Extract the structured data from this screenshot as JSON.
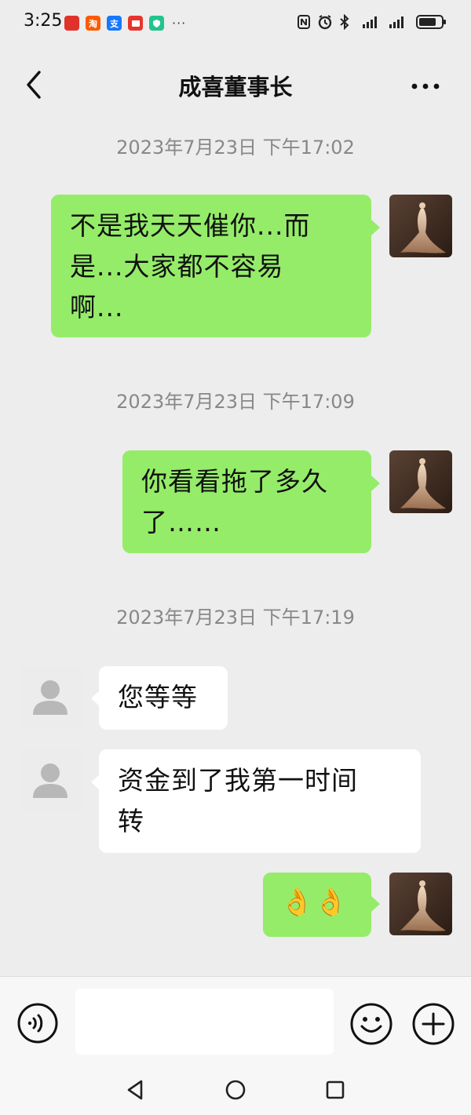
{
  "status_bar": {
    "time": "3:25",
    "app_icons": [
      {
        "name": "huawei-mall-icon",
        "color": "#e0322b",
        "glyph": ""
      },
      {
        "name": "taobao-icon",
        "color": "#ff5a00",
        "glyph": "淘"
      },
      {
        "name": "alipay-icon",
        "color": "#1677ff",
        "glyph": "支"
      },
      {
        "name": "message-app-icon",
        "color": "#e8342c",
        "glyph": ""
      },
      {
        "name": "security-shield-icon",
        "color": "#21c48c",
        "glyph": ""
      }
    ],
    "more": "···"
  },
  "header": {
    "title": "成喜董事长"
  },
  "messages": [
    {
      "type": "timestamp",
      "text": "2023年7月23日 下午17:02"
    },
    {
      "type": "sent",
      "lines": [
        "不是我天天催你...而",
        "是...大家都不容易",
        "啊..."
      ]
    },
    {
      "type": "timestamp",
      "text": "2023年7月23日 下午17:09"
    },
    {
      "type": "sent",
      "lines": [
        "你看看拖了多久",
        "了……"
      ]
    },
    {
      "type": "timestamp",
      "text": "2023年7月23日 下午17:19"
    },
    {
      "type": "received",
      "lines": [
        "您等等"
      ]
    },
    {
      "type": "received",
      "lines": [
        "资金到了我第一时间",
        "转"
      ]
    },
    {
      "type": "sent",
      "lines": [
        "👌👌"
      ]
    }
  ],
  "input_bar": {
    "text_value": ""
  },
  "colors": {
    "sent_bubble": "#95ec69",
    "received_bubble": "#ffffff",
    "background": "#ededed"
  }
}
